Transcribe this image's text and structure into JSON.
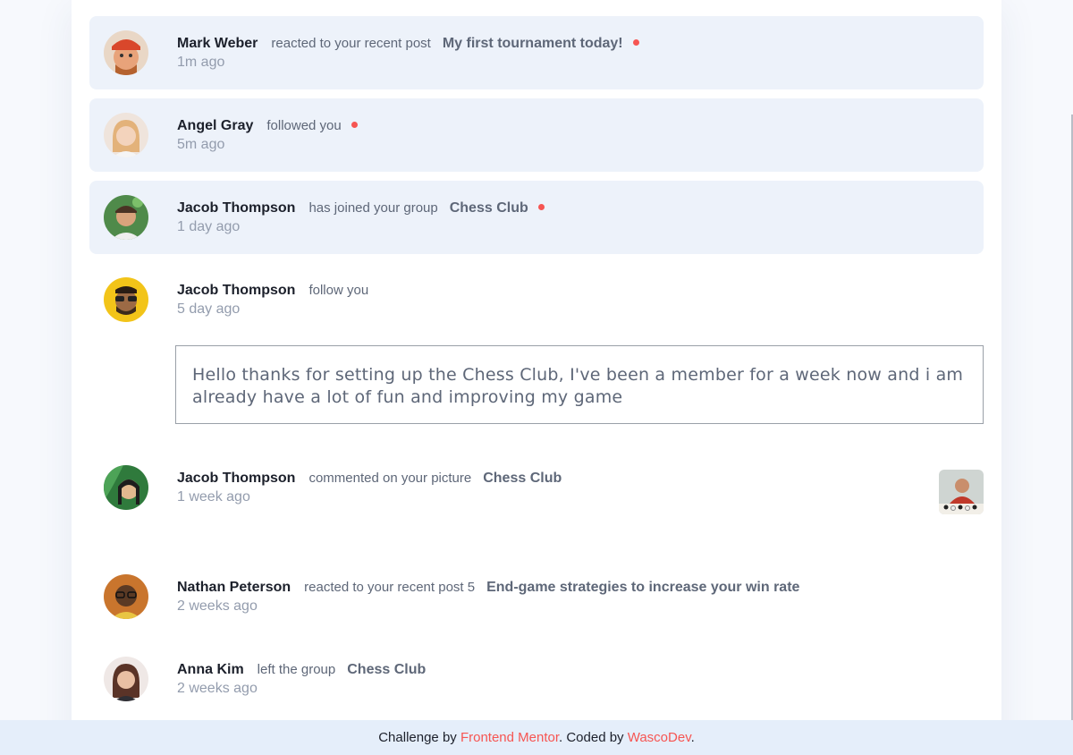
{
  "notifications": [
    {
      "name": "Mark Weber",
      "action": "reacted to your recent post",
      "target": "My first tournament today!",
      "time": "1m ago",
      "unread": true,
      "avatar": "mark-webber-avatar"
    },
    {
      "name": "Angel Gray",
      "action": "followed you",
      "target": "",
      "time": "5m ago",
      "unread": true,
      "avatar": "angela-gray-avatar"
    },
    {
      "name": "Jacob Thompson",
      "action": "has joined your group",
      "target": "Chess Club",
      "time": "1 day ago",
      "unread": true,
      "avatar": "jacob-thompson-avatar"
    },
    {
      "name": "Jacob Thompson",
      "action": "follow you",
      "target": "",
      "time": "5 day ago",
      "unread": false,
      "avatar": "rizky-hasanuddin-avatar"
    },
    {
      "name": "Jacob Thompson",
      "action": "commented on your picture",
      "target": "Chess Club",
      "time": "1 week ago",
      "unread": false,
      "avatar": "kimberly-smith-avatar"
    },
    {
      "name": "Nathan Peterson",
      "action": "reacted to your recent post 5",
      "target": "End-game strategies to increase your win rate",
      "time": "2 weeks ago",
      "unread": false,
      "avatar": "nathan-peterson-avatar"
    },
    {
      "name": "Anna Kim",
      "action": "left the group",
      "target": "Chess Club",
      "time": "2 weeks ago",
      "unread": false,
      "avatar": "anna-kim-avatar"
    }
  ],
  "message": "Hello thanks for setting up the Chess Club, I've been a member for a week now and i am already have a lot of fun and improving my game",
  "footer": {
    "prefix": "Challenge by ",
    "link1": "Frontend Mentor",
    "middle": ". Coded by ",
    "link2": "WascoDev",
    "suffix": "."
  },
  "colors": {
    "accent": "#f65552",
    "unread_bg": "#edf2fa",
    "name": "#1c202b",
    "muted": "#5e6778",
    "time": "#939cad"
  }
}
